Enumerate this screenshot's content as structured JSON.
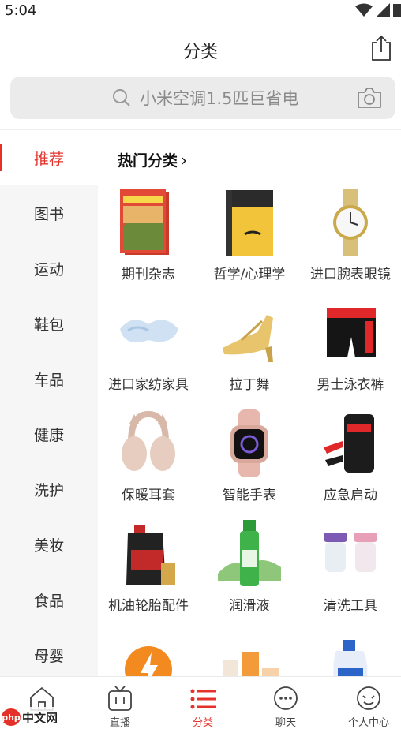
{
  "status_bar": {
    "time": "5:04"
  },
  "header": {
    "title": "分类"
  },
  "search": {
    "placeholder": "小米空调1.5匹巨省电"
  },
  "sidebar": {
    "items": [
      {
        "label": "推荐",
        "active": true
      },
      {
        "label": "图书"
      },
      {
        "label": "运动"
      },
      {
        "label": "鞋包"
      },
      {
        "label": "车品"
      },
      {
        "label": "健康"
      },
      {
        "label": "洗护"
      },
      {
        "label": "美妆"
      },
      {
        "label": "食品"
      },
      {
        "label": "母婴"
      }
    ]
  },
  "section": {
    "title": "热门分类",
    "chevron": "›"
  },
  "categories": [
    {
      "label": "期刊杂志",
      "icon": "magazine-icon"
    },
    {
      "label": "哲学/心理学",
      "icon": "book-icon"
    },
    {
      "label": "进口腕表眼镜",
      "icon": "watch-icon"
    },
    {
      "label": "进口家纺家具",
      "icon": "pillow-icon"
    },
    {
      "label": "拉丁舞",
      "icon": "dance-shoe-icon"
    },
    {
      "label": "男士泳衣裤",
      "icon": "swim-trunks-icon"
    },
    {
      "label": "保暖耳套",
      "icon": "earmuffs-icon"
    },
    {
      "label": "智能手表",
      "icon": "smartwatch-icon"
    },
    {
      "label": "应急启动",
      "icon": "jump-starter-icon"
    },
    {
      "label": "机油轮胎配件",
      "icon": "motor-oil-icon"
    },
    {
      "label": "润滑液",
      "icon": "lubricant-icon"
    },
    {
      "label": "清洗工具",
      "icon": "cleaning-case-icon"
    }
  ],
  "tabbar": {
    "items": [
      {
        "label": "",
        "icon": "home-icon"
      },
      {
        "label": "直播",
        "icon": "tv-icon"
      },
      {
        "label": "分类",
        "icon": "list-icon",
        "active": true
      },
      {
        "label": "聊天",
        "icon": "chat-icon"
      },
      {
        "label": "个人中心",
        "icon": "profile-icon"
      }
    ]
  },
  "watermark": {
    "logo": "php",
    "text": "中文网"
  },
  "colors": {
    "accent": "#e4322b",
    "search_bg": "#ebebeb",
    "sidebar_bg": "#f6f6f6"
  }
}
